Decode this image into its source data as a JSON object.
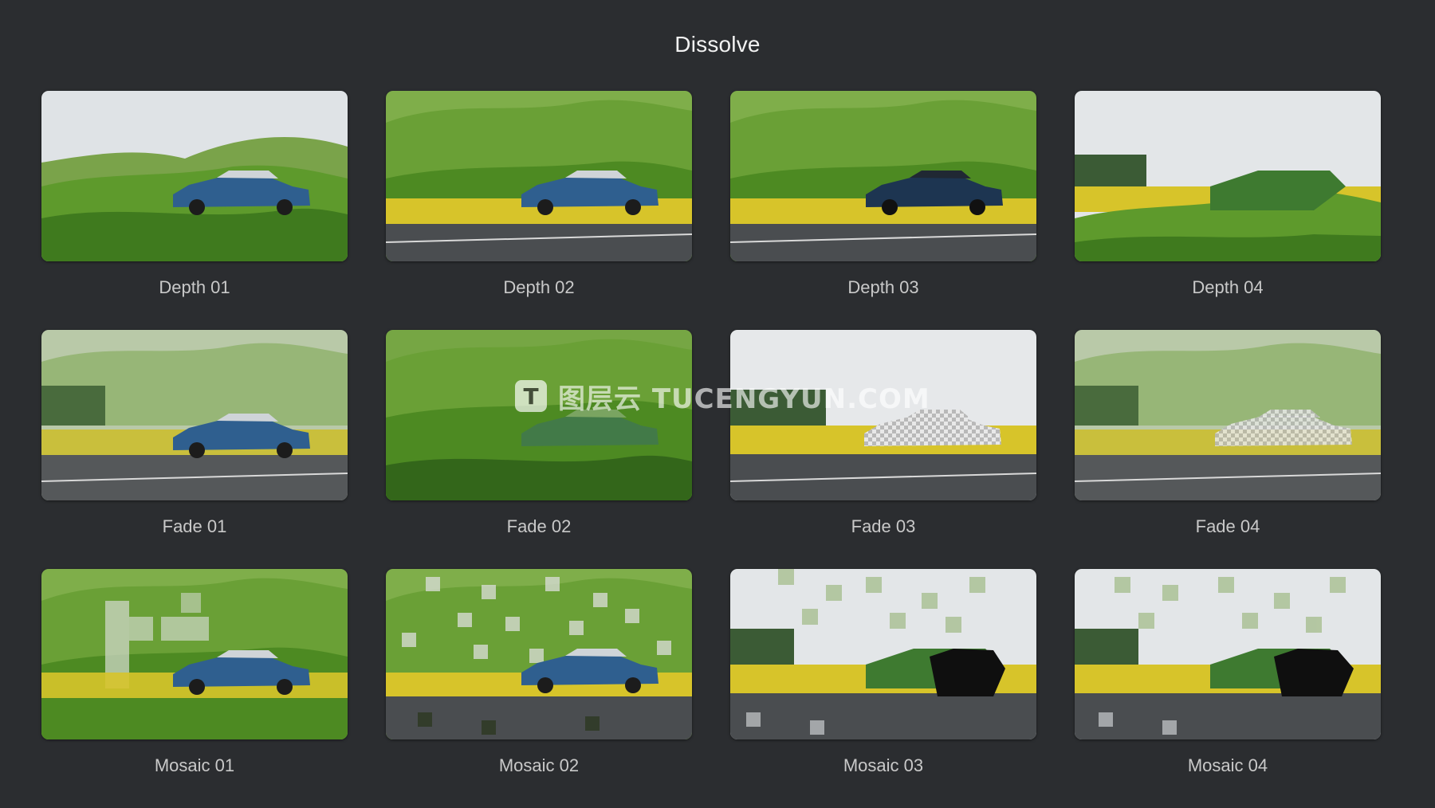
{
  "page": {
    "title": "Dissolve"
  },
  "watermark": {
    "logo": "T",
    "text": "图层云 TUCENGYUN.COM"
  },
  "tiles": [
    {
      "label": "Depth 01",
      "scene": "hills-car-sky"
    },
    {
      "label": "Depth 02",
      "scene": "hills-field-road-car"
    },
    {
      "label": "Depth 03",
      "scene": "hills-field-road-darkcar"
    },
    {
      "label": "Depth 04",
      "scene": "sky-field-hills-partial"
    },
    {
      "label": "Fade 01",
      "scene": "fade-blend-car"
    },
    {
      "label": "Fade 02",
      "scene": "hills-ghost-car"
    },
    {
      "label": "Fade 03",
      "scene": "sky-field-road-checker-car"
    },
    {
      "label": "Fade 04",
      "scene": "hills-fade-checker-car"
    },
    {
      "label": "Mosaic 01",
      "scene": "mosaic-light"
    },
    {
      "label": "Mosaic 02",
      "scene": "mosaic-medium"
    },
    {
      "label": "Mosaic 03",
      "scene": "mosaic-heavy"
    },
    {
      "label": "Mosaic 04",
      "scene": "mosaic-heavy-2"
    }
  ],
  "colors": {
    "background": "#2b2d30",
    "title": "#f2f2f2",
    "label": "#c9c9c9",
    "grass": "#5e9a2c",
    "sky": "#dfe3e6",
    "rapeseed": "#d7c42a",
    "road": "#4a4d50",
    "car": "#2f5f8f"
  }
}
